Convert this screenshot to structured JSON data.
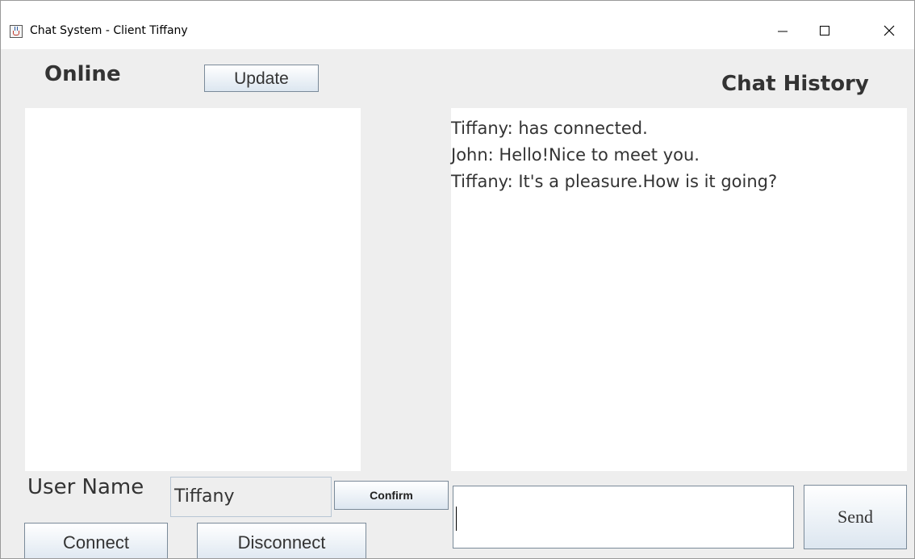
{
  "window": {
    "title": "Chat System - Client Tiffany",
    "controls": {
      "minimize": "minimize",
      "maximize": "maximize",
      "close": "close"
    }
  },
  "online_panel": {
    "label": "Online",
    "update_button": "Update",
    "users": []
  },
  "chat_panel": {
    "label": "Chat History",
    "messages": [
      "Tiffany: has connected.",
      "John: Hello!Nice to meet you.",
      "Tiffany: It's a pleasure.How is it going?"
    ]
  },
  "user_controls": {
    "username_label": "User Name",
    "username_value": "Tiffany",
    "confirm_button": "Confirm",
    "connect_button": "Connect",
    "disconnect_button": "Disconnect"
  },
  "message_composer": {
    "value": "",
    "send_button": "Send"
  },
  "icons": {
    "app": "java-cup-icon",
    "minimize": "minimize-icon",
    "maximize": "maximize-icon",
    "close": "close-icon"
  }
}
